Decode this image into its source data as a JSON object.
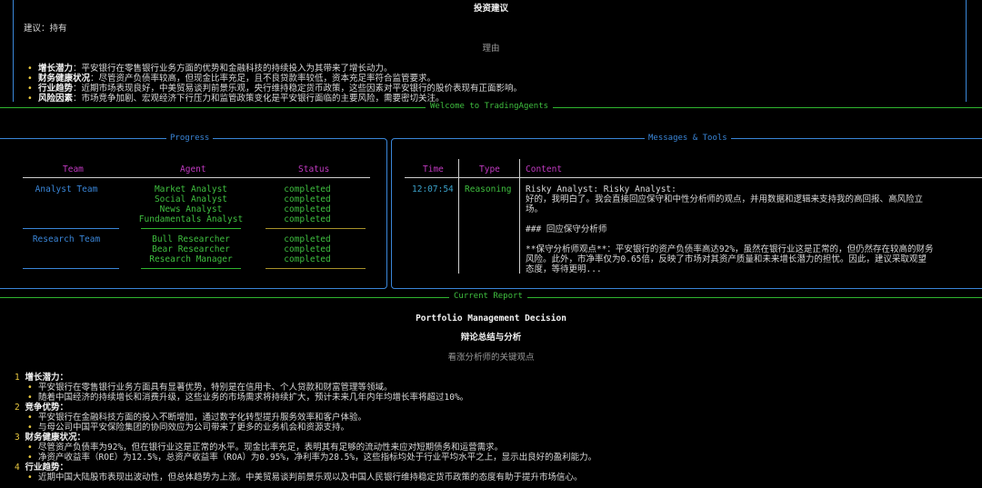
{
  "top_report": {
    "title": "投资建议",
    "recommendation": "建议：持有",
    "reason_heading": "理由",
    "reasons": [
      {
        "label": "增长潜力",
        "text": "：平安银行在零售银行业务方面的优势和金融科技的持续投入为其带来了增长动力。"
      },
      {
        "label": "财务健康状况",
        "text": "：尽管资产负债率较高，但现金比率充足，且不良贷款率较低，资本充足率符合监管要求。"
      },
      {
        "label": "行业趋势",
        "text": "：近期市场表现良好，中美贸易谈判前景乐观，央行维持稳定货币政策，这些因素对平安银行的股价表现有正面影响。"
      },
      {
        "label": "风险因素",
        "text": "：市场竞争加剧、宏观经济下行压力和监管政策变化是平安银行面临的主要风险，需要密切关注。"
      }
    ]
  },
  "welcome_banner": "Welcome to TradingAgents",
  "progress": {
    "title": "Progress",
    "headers": {
      "team": "Team",
      "agent": "Agent",
      "status": "Status"
    },
    "groups": [
      {
        "team": "Analyst Team",
        "rows": [
          {
            "agent": "Market Analyst",
            "status": "completed"
          },
          {
            "agent": "Social Analyst",
            "status": "completed"
          },
          {
            "agent": "News Analyst",
            "status": "completed"
          },
          {
            "agent": "Fundamentals Analyst",
            "status": "completed"
          }
        ]
      },
      {
        "team": "Research Team",
        "rows": [
          {
            "agent": "Bull Researcher",
            "status": "completed"
          },
          {
            "agent": "Bear Researcher",
            "status": "completed"
          },
          {
            "agent": "Research Manager",
            "status": "completed"
          }
        ]
      }
    ]
  },
  "messages": {
    "title": "Messages & Tools",
    "headers": {
      "time": "Time",
      "type": "Type",
      "content": "Content"
    },
    "rows": [
      {
        "time": "12:07:54",
        "type": "Reasoning",
        "content_lines": [
          "Risky Analyst: Risky Analyst:",
          "好的，我明白了。我会直接回应保守和中性分析师的观点，并用数据和逻辑来支持我的高回报、高风险立",
          "场。",
          "",
          "### 回应保守分析师",
          "",
          "**保守分析师观点**：平安银行的资产负债率高达92%，虽然在银行业这是正常的，但仍然存在较高的财务",
          "风险。此外，市净率仅为0.65倍，反映了市场对其资产质量和未来增长潜力的担忧。因此，建议采取观望",
          "态度，等待更明..."
        ]
      }
    ]
  },
  "current_report": {
    "banner": "Current Report",
    "title": "Portfolio Management Decision",
    "subtitle": "辩论总结与分析",
    "section_heading": "看涨分析师的关键观点",
    "items": [
      {
        "num": "1",
        "heading": "增长潜力：",
        "bullets": [
          "平安银行在零售银行业务方面具有显著优势，特别是在信用卡、个人贷款和财富管理等领域。",
          "随着中国经济的持续增长和消费升级，这些业务的市场需求将持续扩大，预计未来几年内年均增长率将超过10%。"
        ]
      },
      {
        "num": "2",
        "heading": "竞争优势：",
        "bullets": [
          "平安银行在金融科技方面的投入不断增加，通过数字化转型提升服务效率和客户体验。",
          "与母公司中国平安保险集团的协同效应为公司带来了更多的业务机会和资源支持。"
        ]
      },
      {
        "num": "3",
        "heading": "财务健康状况：",
        "bullets": [
          "尽管资产负债率为92%，但在银行业这是正常的水平。现金比率充足，表明其有足够的流动性来应对短期债务和运营需求。",
          "净资产收益率（ROE）为12.5%，总资产收益率（ROA）为0.95%，净利率为28.5%，这些指标均处于行业平均水平之上，显示出良好的盈利能力。"
        ]
      },
      {
        "num": "4",
        "heading": "行业趋势：",
        "bullets": [
          "近期中国大陆股市表现出波动性，但总体趋势为上涨。中美贸易谈判前景乐观以及中国人民银行维持稳定货币政策的态度有助于提升市场信心。"
        ]
      }
    ]
  },
  "colors": {
    "border_blue": "#3a86d8",
    "rule_green": "#2fb52f",
    "header_magenta": "#c03ac0",
    "status_green": "#3fbf3f",
    "accent_yellow": "#e8c840"
  }
}
